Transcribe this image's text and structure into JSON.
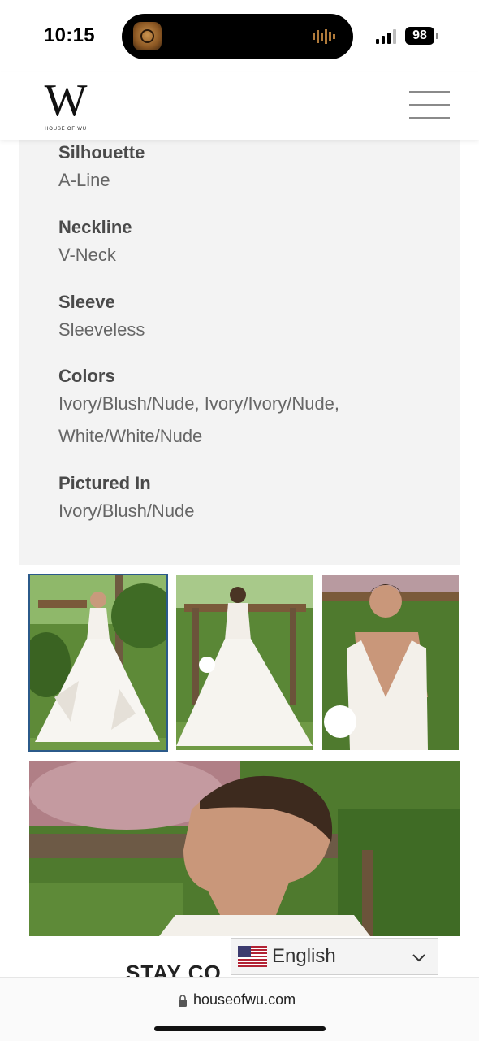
{
  "status_bar": {
    "time": "10:15",
    "battery": "98"
  },
  "header": {
    "logo_letter": "W",
    "logo_text": "HOUSE OF WU"
  },
  "details": [
    {
      "label": "Silhouette",
      "value": "A-Line"
    },
    {
      "label": "Neckline",
      "value": "V-Neck"
    },
    {
      "label": "Sleeve",
      "value": "Sleeveless"
    },
    {
      "label": "Colors",
      "value_line1": "Ivory/Blush/Nude, Ivory/Ivory/Nude,",
      "value_line2": "White/White/Nude"
    },
    {
      "label": "Pictured In",
      "value": "Ivory/Blush/Nude"
    }
  ],
  "gallery": {
    "selected_index": 0
  },
  "footer": {
    "heading_partial": "STAY CO"
  },
  "language": {
    "selected": "English"
  },
  "browser": {
    "url": "houseofwu.com"
  },
  "colors": {
    "card_bg": "#f3f3f3",
    "selected_border": "#2b5a8a",
    "foliage": "#4f7a2e"
  }
}
